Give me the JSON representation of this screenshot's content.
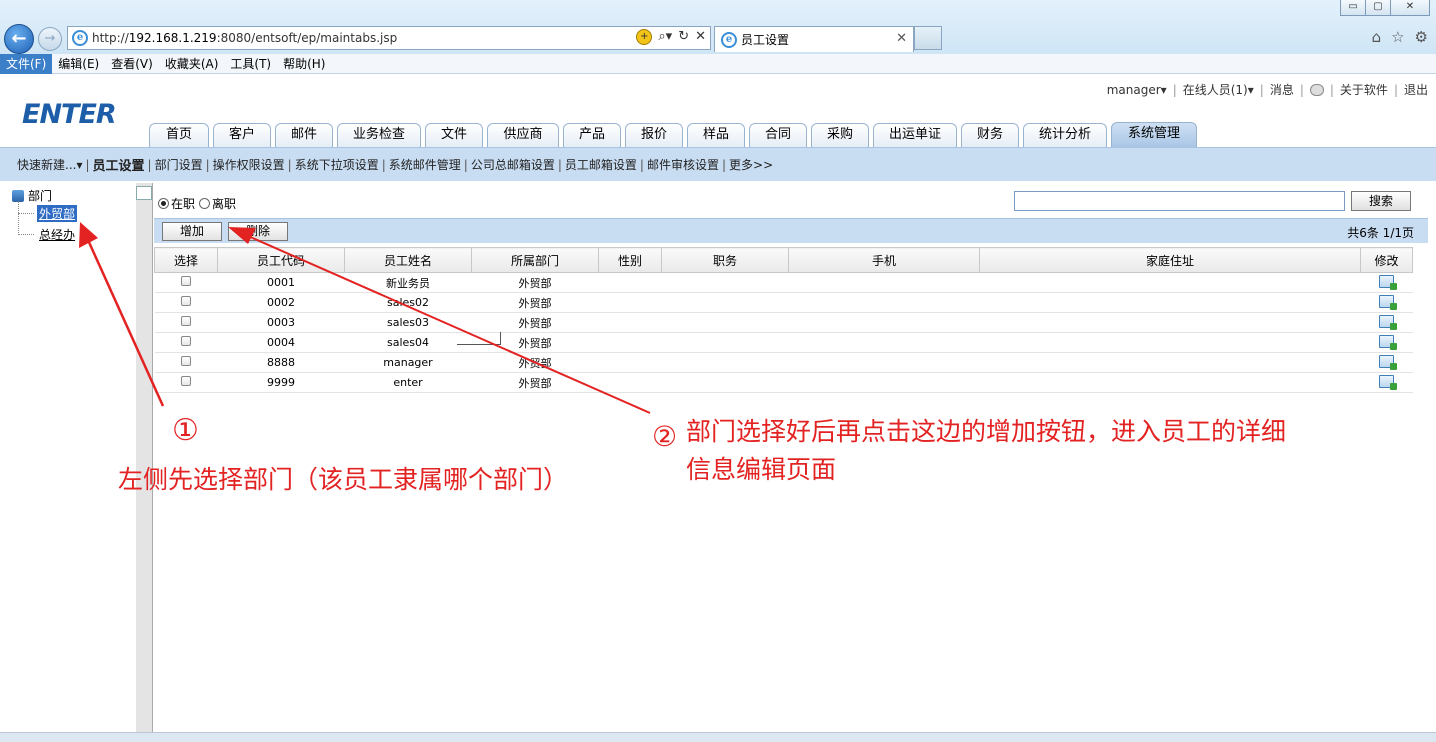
{
  "browser": {
    "window_buttons": [
      "▭",
      "▢",
      "✕"
    ],
    "url_prefix": "http://",
    "url_host": "192.168.1.219",
    "url_rest": ":8080/entsoft/ep/maintabs.jsp",
    "tab_title": "员工设置",
    "menu": [
      "文件(F)",
      "编辑(E)",
      "查看(V)",
      "收藏夹(A)",
      "工具(T)",
      "帮助(H)"
    ]
  },
  "header": {
    "logo": "ENTER",
    "user": "manager▾",
    "online": "在线人员(1)▾",
    "messages": "消息",
    "about": "关于软件",
    "logout": "退出"
  },
  "main_tabs": [
    "首页",
    "客户",
    "邮件",
    "业务检查",
    "文件",
    "供应商",
    "产品",
    "报价",
    "样品",
    "合同",
    "采购",
    "出运单证",
    "财务",
    "统计分析",
    "系统管理"
  ],
  "sub_nav": {
    "quick": "快速新建...▾",
    "items": [
      "员工设置",
      "部门设置",
      "操作权限设置",
      "系统下拉项设置",
      "系统邮件管理",
      "公司总邮箱设置",
      "员工邮箱设置",
      "邮件审核设置",
      "更多>>"
    ]
  },
  "tree": {
    "root": "部门",
    "items": [
      "外贸部",
      "总经办"
    ]
  },
  "filter": {
    "active_label": "在职",
    "left_label": "离职",
    "search_value": "",
    "search_button": "搜索"
  },
  "toolbar": {
    "add": "增加",
    "delete": "删除",
    "pager": "共6条  1/1页"
  },
  "table": {
    "headers": [
      "选择",
      "员工代码",
      "员工姓名",
      "所属部门",
      "性别",
      "职务",
      "手机",
      "家庭住址",
      "修改"
    ],
    "rows": [
      {
        "code": "0001",
        "name": "新业务员",
        "dept": "外贸部"
      },
      {
        "code": "0002",
        "name": "sales02",
        "dept": "外贸部"
      },
      {
        "code": "0003",
        "name": "sales03",
        "dept": "外贸部"
      },
      {
        "code": "0004",
        "name": "sales04",
        "dept": "外贸部"
      },
      {
        "code": "8888",
        "name": "manager",
        "dept": "外贸部"
      },
      {
        "code": "9999",
        "name": "enter",
        "dept": "外贸部"
      }
    ]
  },
  "annotations": {
    "num1": "①",
    "text1": "左侧先选择部门（该员工隶属哪个部门）",
    "num2": "②",
    "text2_line1": "部门选择好后再点击这边的增加按钮，进入员工的详细",
    "text2_line2": "信息编辑页面",
    "color": "#e32222"
  }
}
